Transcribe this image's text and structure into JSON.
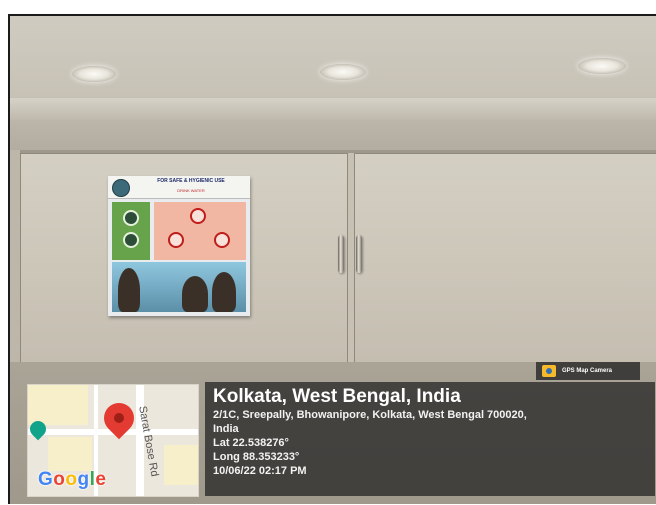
{
  "photo": {
    "subject": "",
    "poster": {
      "title": "FOR SAFE & HYGIENIC USE",
      "subtitle": "DRINK WATER"
    }
  },
  "map": {
    "road_label": "Sarat Bose Rd",
    "brand": "Google",
    "brand_colors": [
      "#4285F4",
      "#EA4335",
      "#FBBC05",
      "#4285F4",
      "#34A853",
      "#EA4335"
    ],
    "pin_color": "#E33B32",
    "icons": [
      "location-pin-icon",
      "poi-marker-icon"
    ]
  },
  "gps_badge": {
    "label": "GPS Map Camera",
    "icon": "gps-map-camera-icon"
  },
  "location": {
    "title": "Kolkata, West Bengal, India",
    "address_line1": "2/1C, Sreepally, Bhowanipore, Kolkata, West Bengal 700020,",
    "address_line2": "India",
    "lat": "Lat 22.538276°",
    "long": "Long 88.353233°",
    "datetime": "10/06/22 02:17 PM"
  }
}
